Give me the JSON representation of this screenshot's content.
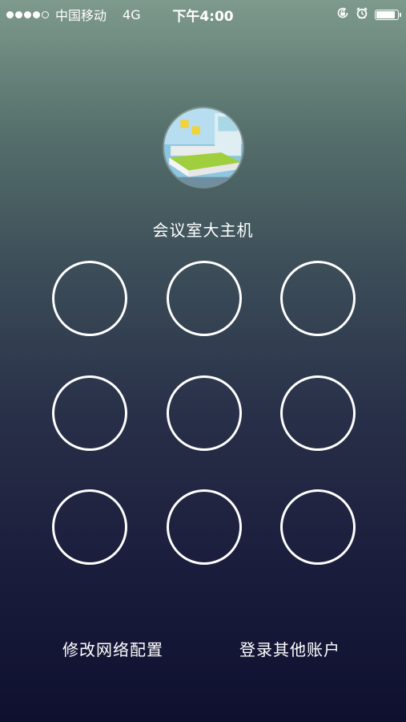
{
  "status_bar": {
    "carrier": "中国移动",
    "network": "4G",
    "time": "下午4:00",
    "battery_level": 0.9,
    "signal_bars_filled": 4,
    "signal_bars_total": 5,
    "icons": [
      "rotation-lock-icon",
      "alarm-icon",
      "battery-icon"
    ]
  },
  "profile": {
    "device_name": "会议室大主机"
  },
  "pattern": {
    "rows": 3,
    "cols": 3,
    "node_color": "#ffffff"
  },
  "footer": {
    "modify_network_label": "修改网络配置",
    "login_other_label": "登录其他账户"
  }
}
